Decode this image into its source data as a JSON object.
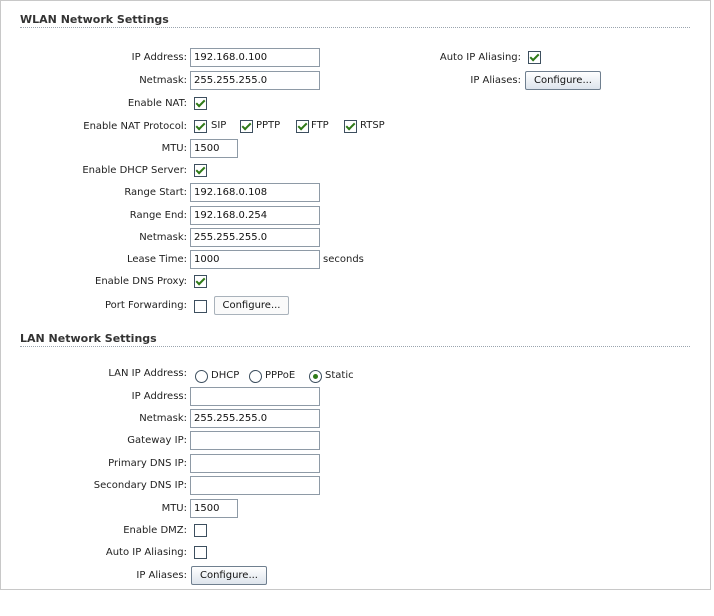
{
  "wlan": {
    "title": "WLAN Network Settings",
    "ip_address_label": "IP Address:",
    "ip_address": "192.168.0.100",
    "netmask_label": "Netmask:",
    "netmask": "255.255.255.0",
    "auto_ip_aliasing_label": "Auto IP Aliasing:",
    "auto_ip_aliasing": true,
    "ip_aliases_label": "IP Aliases:",
    "configure_label": "Configure...",
    "enable_nat_label": "Enable NAT:",
    "enable_nat": true,
    "nat_protocol_label": "Enable NAT Protocol:",
    "nat_protocols": [
      {
        "label": "SIP",
        "checked": true
      },
      {
        "label": "PPTP",
        "checked": true
      },
      {
        "label": "FTP",
        "checked": true
      },
      {
        "label": "RTSP",
        "checked": true
      }
    ],
    "mtu_label": "MTU:",
    "mtu": "1500",
    "enable_dhcp_label": "Enable DHCP Server:",
    "enable_dhcp": true,
    "range_start_label": "Range Start:",
    "range_start": "192.168.0.108",
    "range_end_label": "Range End:",
    "range_end": "192.168.0.254",
    "dhcp_netmask_label": "Netmask:",
    "dhcp_netmask": "255.255.255.0",
    "lease_time_label": "Lease Time:",
    "lease_time": "1000",
    "lease_unit": "seconds",
    "dns_proxy_label": "Enable DNS Proxy:",
    "dns_proxy": true,
    "port_forwarding_label": "Port Forwarding:",
    "port_forwarding": false,
    "port_forwarding_configure": "Configure..."
  },
  "lan": {
    "title": "LAN Network Settings",
    "lan_ip_label": "LAN IP Address:",
    "lan_ip_modes": [
      {
        "label": "DHCP",
        "selected": false
      },
      {
        "label": "PPPoE",
        "selected": false
      },
      {
        "label": "Static",
        "selected": true
      }
    ],
    "ip_address_label": "IP Address:",
    "ip_address": "",
    "netmask_label": "Netmask:",
    "netmask": "255.255.255.0",
    "gateway_label": "Gateway IP:",
    "gateway": "",
    "primary_dns_label": "Primary DNS IP:",
    "primary_dns": "",
    "secondary_dns_label": "Secondary DNS IP:",
    "secondary_dns": "",
    "mtu_label": "MTU:",
    "mtu": "1500",
    "enable_dmz_label": "Enable DMZ:",
    "enable_dmz": false,
    "auto_ip_aliasing_label": "Auto IP Aliasing:",
    "auto_ip_aliasing": false,
    "ip_aliases_label": "IP Aliases:",
    "configure_label": "Configure..."
  },
  "colors": {
    "check": "#2f7a18",
    "rule": "#9aa4ae",
    "input_border": "#8e9aa6"
  }
}
